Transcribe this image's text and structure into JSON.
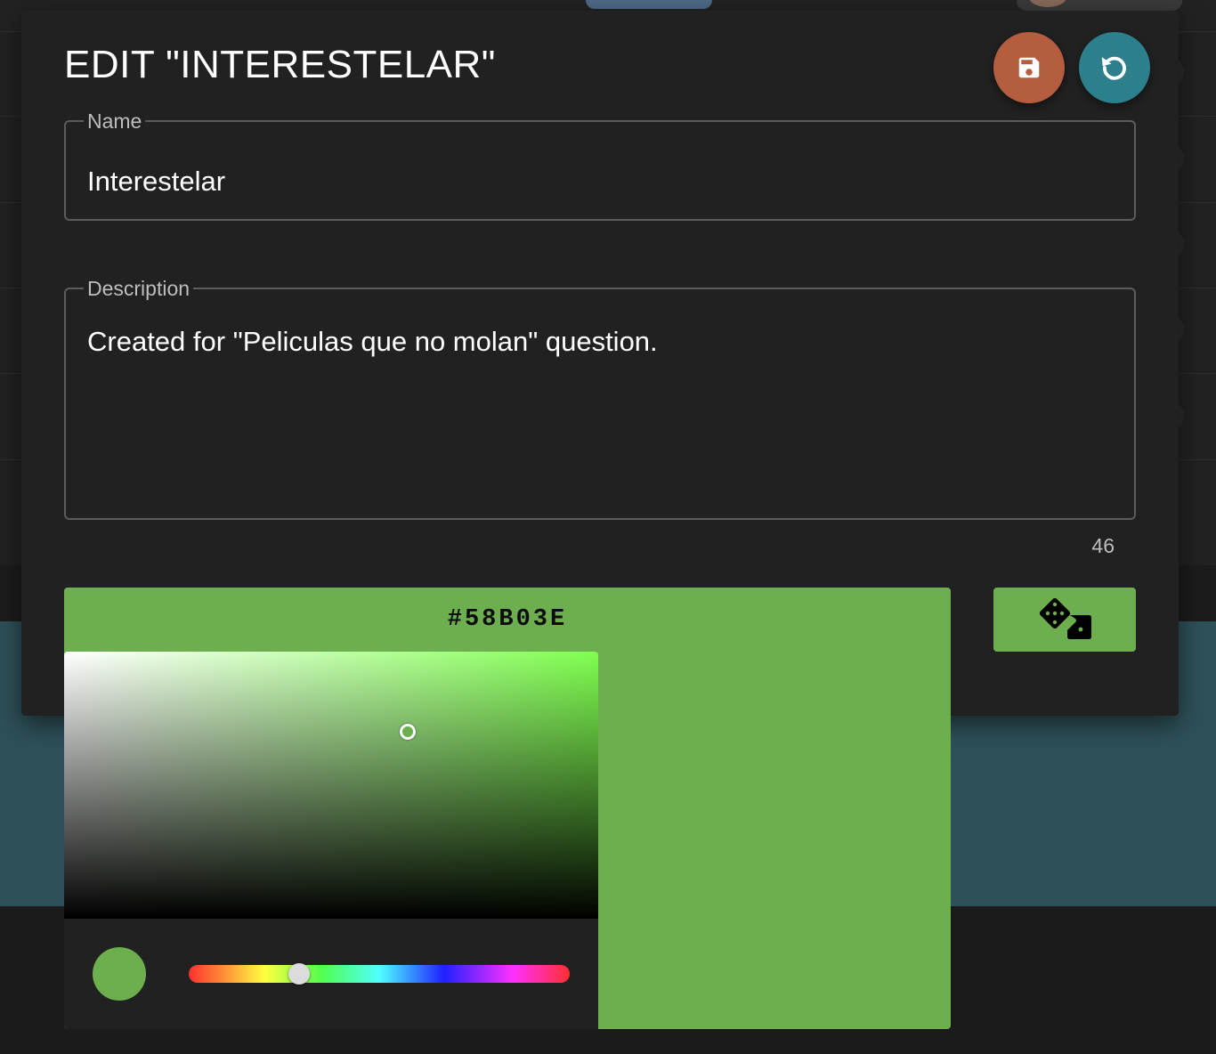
{
  "dialog": {
    "title": "EDIT \"INTERESTELAR\"",
    "actions": {
      "save_icon": "floppy-disk-icon",
      "reset_icon": "undo-icon"
    }
  },
  "form": {
    "name": {
      "label": "Name",
      "value": "Interestelar"
    },
    "description": {
      "label": "Description",
      "value": "Created for \"Peliculas que no molan\" question.",
      "char_count": "46"
    }
  },
  "color_picker": {
    "hex_value": "#58B03E",
    "random_icon": "dice-icon",
    "hue_position": 0.29
  },
  "colors": {
    "dialog_bg": "#212121",
    "save_button": "#b55e3f",
    "reset_button": "#2e7f8c",
    "selected_color": "#6daf4e",
    "backdrop_teal": "#2e5159"
  }
}
